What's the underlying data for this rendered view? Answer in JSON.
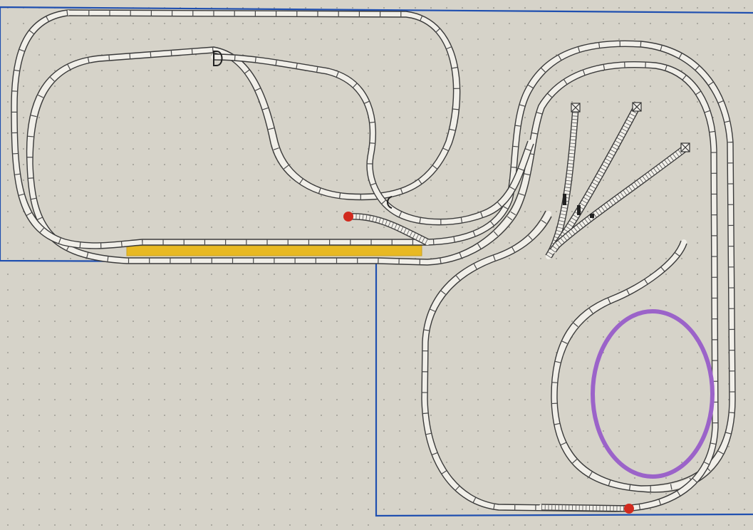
{
  "app": {
    "view": "track-plan-canvas"
  },
  "colors": {
    "background": "#d6d3c9",
    "grid_dot": "#8c8a84",
    "baseboard_outline": "#1f4fb0",
    "track_bed": "#f1efe9",
    "track_rail": "#3a3a3a",
    "platform": "#e8b923",
    "track_end": "#d12a1e",
    "marker_ring": "#9b63c9"
  },
  "icons": {
    "track_end": "red-dot-buffer-icon",
    "siding_end": "cross-box-buffer-icon",
    "uncoupler": "d-shaped-uncoupler-icon",
    "signal": "signal-icon"
  }
}
